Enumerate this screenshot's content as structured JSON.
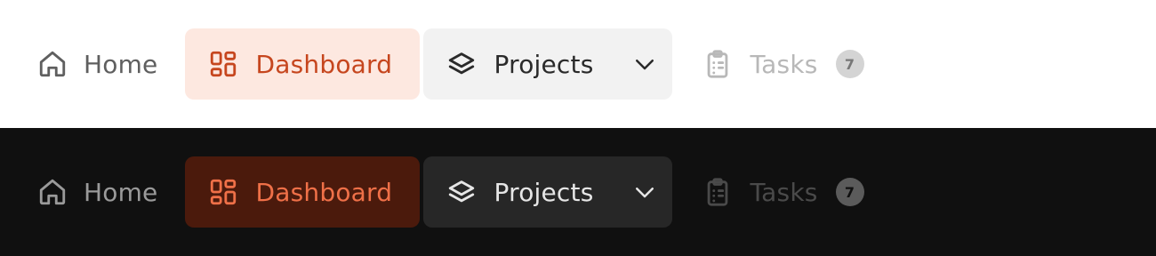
{
  "themes": {
    "light": {
      "background": "#ffffff",
      "nav": {
        "home": {
          "label": "Home",
          "icon": "home-icon"
        },
        "dashboard": {
          "label": "Dashboard",
          "icon": "dashboard-grid-icon",
          "state": "active",
          "accent": "#c6461e"
        },
        "projects": {
          "label": "Projects",
          "icon": "layers-icon",
          "dropdown_icon": "chevron-down-icon",
          "state": "hover"
        },
        "tasks": {
          "label": "Tasks",
          "icon": "clipboard-list-icon",
          "state": "disabled",
          "badge": "7"
        }
      }
    },
    "dark": {
      "background": "#101010",
      "nav": {
        "home": {
          "label": "Home",
          "icon": "home-icon"
        },
        "dashboard": {
          "label": "Dashboard",
          "icon": "dashboard-grid-icon",
          "state": "active",
          "accent": "#ef7048"
        },
        "projects": {
          "label": "Projects",
          "icon": "layers-icon",
          "dropdown_icon": "chevron-down-icon",
          "state": "hover"
        },
        "tasks": {
          "label": "Tasks",
          "icon": "clipboard-list-icon",
          "state": "disabled",
          "badge": "7"
        }
      }
    }
  }
}
